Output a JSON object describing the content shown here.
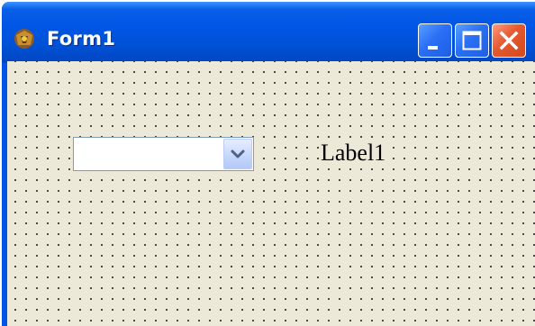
{
  "window": {
    "title": "Form1",
    "controls": {
      "minimize_icon": "minimize-icon",
      "maximize_icon": "maximize-icon",
      "close_icon": "close-icon"
    }
  },
  "form": {
    "combobox": {
      "value": ""
    },
    "label1": {
      "text": "Label1"
    }
  },
  "colors": {
    "titlebar": "#0055e5",
    "client_background": "#ece9d8",
    "close_button": "#e5582f"
  }
}
